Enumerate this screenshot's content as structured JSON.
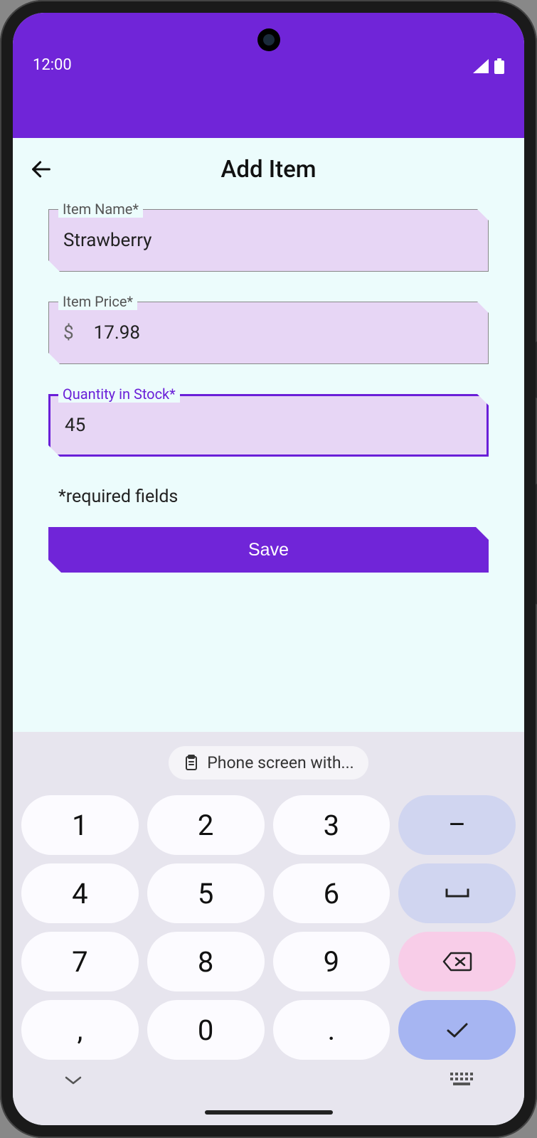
{
  "status": {
    "time": "12:00"
  },
  "page": {
    "title": "Add Item"
  },
  "form": {
    "item_name": {
      "label": "Item Name*",
      "value": "Strawberry"
    },
    "item_price": {
      "label": "Item Price*",
      "prefix": "$",
      "value": "17.98"
    },
    "quantity": {
      "label": "Quantity in Stock*",
      "value": "45"
    },
    "required_note": "*required fields",
    "save_label": "Save"
  },
  "keyboard": {
    "suggestion": "Phone screen with...",
    "keys": {
      "k1": "1",
      "k2": "2",
      "k3": "3",
      "k4": "4",
      "k5": "5",
      "k6": "6",
      "k7": "7",
      "k8": "8",
      "k9": "9",
      "comma": ",",
      "k0": "0",
      "dot": ".",
      "dash": "–",
      "space": "␣"
    }
  }
}
